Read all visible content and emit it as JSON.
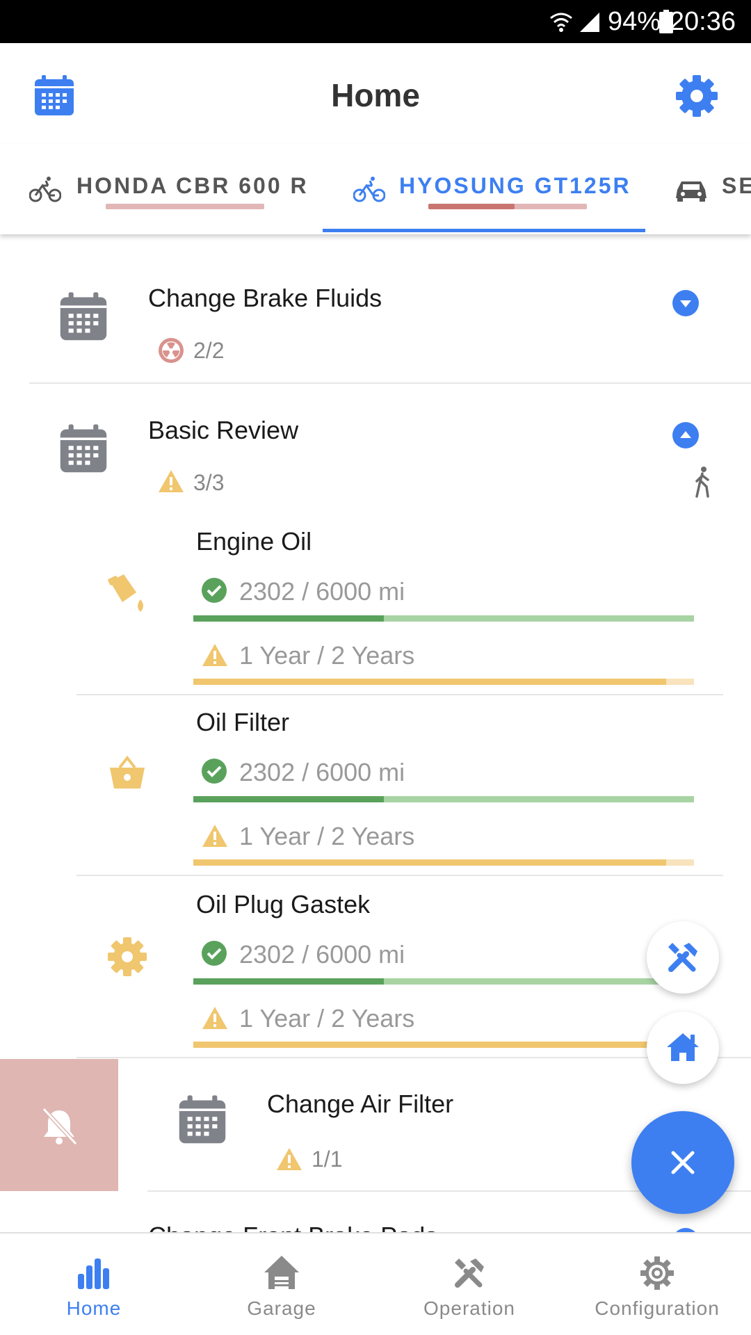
{
  "status_bar": {
    "battery": "94%",
    "time": "20:36"
  },
  "app_bar": {
    "title": "Home",
    "calendar_icon": "calendar-icon",
    "settings_icon": "gear-icon"
  },
  "tabs": [
    {
      "label": "HONDA CBR 600 R",
      "icon": "bicycle-icon",
      "active": false
    },
    {
      "label": "HYOSUNG GT125R",
      "icon": "bicycle-icon",
      "active": true
    },
    {
      "label": "SE",
      "icon": "car-icon",
      "active": false
    }
  ],
  "rows": [
    {
      "title": "Change Brake Fluids",
      "count": "2/2",
      "status_icon": "radiation-icon",
      "expanded": false
    },
    {
      "title": "Basic Review",
      "count": "3/3",
      "status_icon": "warning-icon",
      "expanded": true,
      "items": [
        {
          "title": "Engine Oil",
          "icon": "oil-can-icon",
          "distance": "2302 / 6000 mi",
          "distance_progress": 0.38,
          "time": "1 Year / 2 Years",
          "time_progress": 0.945
        },
        {
          "title": "Oil Filter",
          "icon": "basket-icon",
          "distance": "2302 / 6000 mi",
          "distance_progress": 0.38,
          "time": "1 Year / 2 Years",
          "time_progress": 0.945
        },
        {
          "title": "Oil Plug Gastek",
          "icon": "gear-icon",
          "distance": "2302 / 6000 mi",
          "distance_progress": 0.38,
          "time": "1 Year / 2 Years",
          "time_progress": 0.945
        }
      ]
    },
    {
      "title": "Change Air Filter",
      "count": "1/1",
      "status_icon": "warning-icon",
      "swiped": true,
      "swipe_icon": "bell-off-icon"
    },
    {
      "title": "Change Front Brake Pads",
      "partial": true
    }
  ],
  "fab": {
    "tools_icon": "tools-icon",
    "home_icon": "home-icon",
    "close_icon": "close-icon"
  },
  "bottom_nav": [
    {
      "label": "Home",
      "icon": "bar-chart-icon",
      "active": true
    },
    {
      "label": "Garage",
      "icon": "garage-icon",
      "active": false
    },
    {
      "label": "Operation",
      "icon": "tools-icon",
      "active": false
    },
    {
      "label": "Configuration",
      "icon": "cog-icon",
      "active": false
    }
  ],
  "colors": {
    "accent": "#3d7ff1",
    "green": "#5aa25c",
    "green_light": "#a8d3a3",
    "yellow": "#f0c66e",
    "red_swipe": "#dfb6b2",
    "icon_grey": "#80828a",
    "tab_pink": "#e2b7b7",
    "tab_red": "#c97671"
  }
}
